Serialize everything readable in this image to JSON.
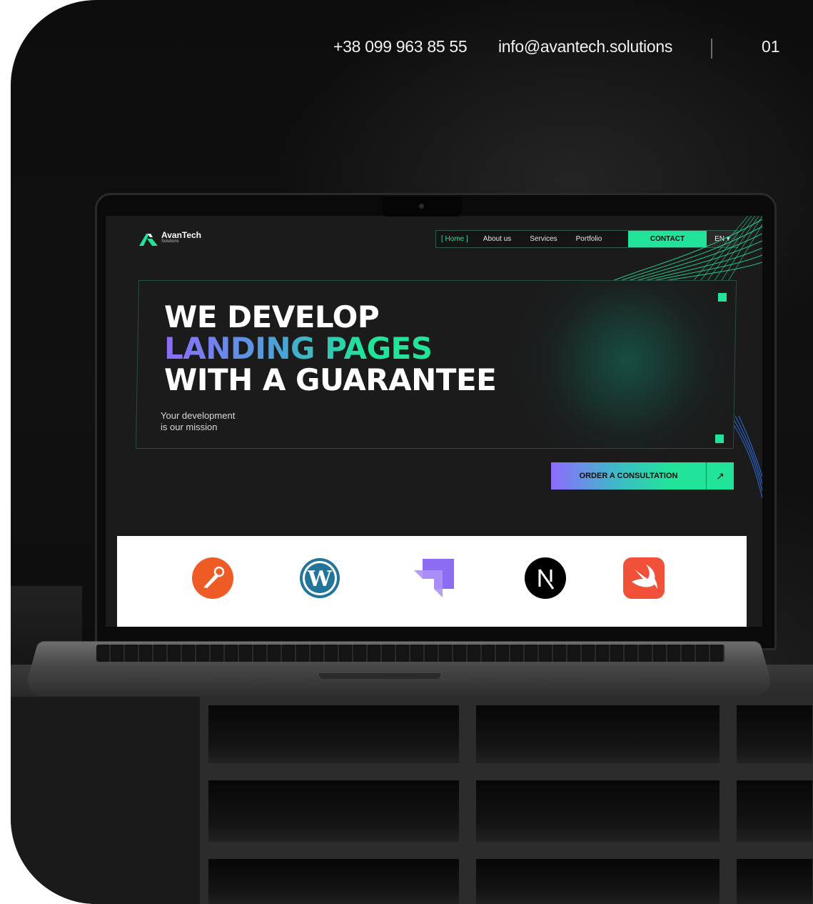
{
  "contact": {
    "phone": "+38 099 963 85 55",
    "email": "info@avantech.solutions",
    "page_number": "01"
  },
  "site": {
    "brand_name": "AvanTech",
    "brand_sub": "Solutions",
    "nav": [
      {
        "label": "[ Home ]",
        "active": true
      },
      {
        "label": "About us"
      },
      {
        "label": "Services"
      },
      {
        "label": "Portfolio"
      }
    ],
    "contact_button": "CONTACT",
    "language": "EN ▾",
    "headline": {
      "line1": "WE DEVELOP",
      "line2": "LANDING PAGES",
      "line3": "WITH A GUARANTEE"
    },
    "subline": {
      "line1": "Your development",
      "line2": "is our mission"
    },
    "cta_label": "ORDER A CONSULTATION",
    "cta_icon": "↗",
    "tech_logos": [
      "postman-icon",
      "wordpress-icon",
      "strapi-icon",
      "nextjs-icon",
      "swift-icon"
    ]
  },
  "colors": {
    "accent_green": "#22e39a",
    "accent_purple": "#8f6bff",
    "background": "#0d0d0d",
    "site_background": "#1b1b1b"
  }
}
